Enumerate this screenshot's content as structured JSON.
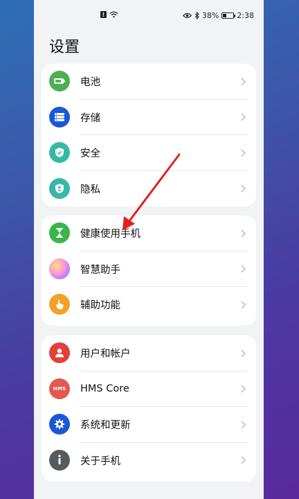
{
  "status_bar": {
    "alert_icon": "!",
    "battery_percent": "38%",
    "battery_level": 0.38,
    "time": "2:38"
  },
  "page_title": "设置",
  "groups": [
    {
      "items": [
        {
          "label": "电池",
          "icon": "battery-icon",
          "color": "#4caf50"
        },
        {
          "label": "存储",
          "icon": "storage-icon",
          "color": "#1b58d6"
        },
        {
          "label": "安全",
          "icon": "security-shield-icon",
          "color": "#37b8a6"
        },
        {
          "label": "隐私",
          "icon": "privacy-shield-icon",
          "color": "#37b8a6"
        }
      ]
    },
    {
      "items": [
        {
          "label": "健康使用手机",
          "icon": "hourglass-icon",
          "color": "#3bb54a"
        },
        {
          "label": "智慧助手",
          "icon": "smart-assistant-icon",
          "color": "#e07ad0"
        },
        {
          "label": "辅助功能",
          "icon": "hand-icon",
          "color": "#f2a127"
        }
      ]
    },
    {
      "items": [
        {
          "label": "用户和帐户",
          "icon": "user-icon",
          "color": "#e0413a"
        },
        {
          "label": "HMS Core",
          "icon": "hms-icon",
          "color": "#e3584f",
          "badge": "HMS"
        },
        {
          "label": "系统和更新",
          "icon": "gear-icon",
          "color": "#1b58d6"
        },
        {
          "label": "关于手机",
          "icon": "info-icon",
          "color": "#555b61"
        }
      ]
    }
  ],
  "annotation": {
    "color": "#e02020"
  }
}
